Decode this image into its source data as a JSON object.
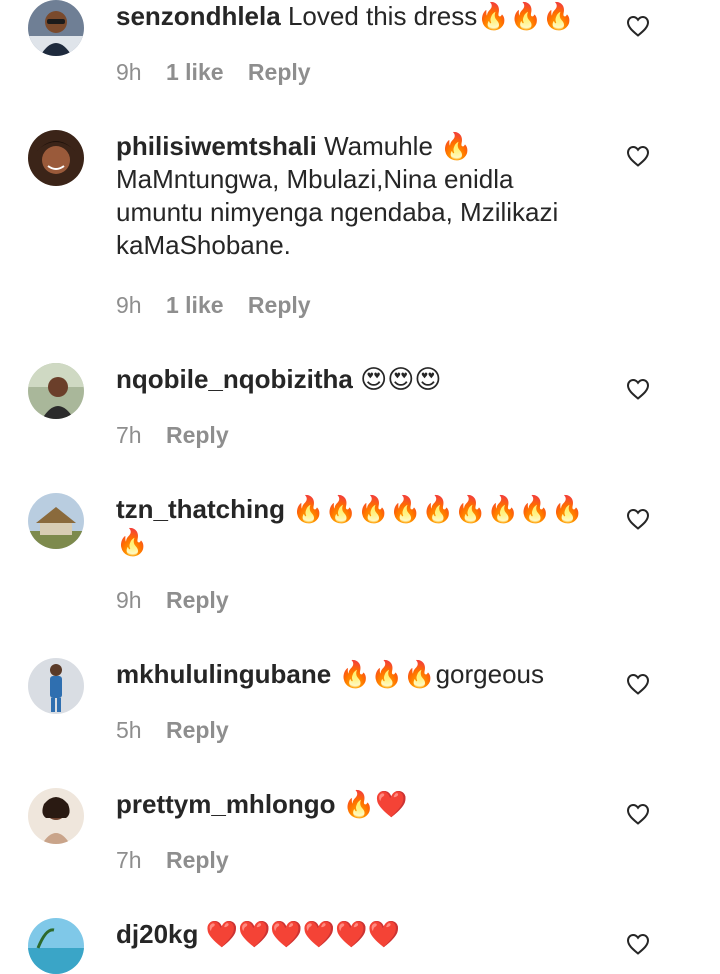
{
  "comments": [
    {
      "username": "senzondhlela",
      "text": "Loved this dress🔥🔥🔥",
      "time": "9h",
      "likes": "1 like",
      "reply": "Reply",
      "avatar_icon": "profile-photo-man-sunglasses"
    },
    {
      "username": "philisiwemtshali",
      "text": "Wamuhle 🔥 MaMntungwa, Mbulazi,Nina enidla umuntu nimyenga ngendaba, Mzilikazi kaMaShobane.",
      "time": "9h",
      "likes": "1 like",
      "reply": "Reply",
      "avatar_icon": "profile-photo-woman-smiling"
    },
    {
      "username": "nqobile_nqobizitha",
      "text": "😍😍😍",
      "time": "7h",
      "likes": "",
      "reply": "Reply",
      "avatar_icon": "profile-photo-woman-outdoors"
    },
    {
      "username": "tzn_thatching",
      "text": "🔥🔥🔥🔥🔥🔥🔥🔥🔥🔥",
      "time": "9h",
      "likes": "",
      "reply": "Reply",
      "avatar_icon": "profile-photo-thatched-house"
    },
    {
      "username": "mkhululingubane",
      "text": "🔥🔥🔥gorgeous",
      "time": "5h",
      "likes": "",
      "reply": "Reply",
      "avatar_icon": "profile-photo-man-standing"
    },
    {
      "username": "prettym_mhlongo",
      "text": "🔥❤️",
      "time": "7h",
      "likes": "",
      "reply": "Reply",
      "avatar_icon": "profile-photo-woman-portrait"
    },
    {
      "username": "dj20kg",
      "text": "❤️❤️❤️❤️❤️❤️",
      "time": "",
      "likes": "",
      "reply": "",
      "avatar_icon": "profile-photo-beach"
    }
  ],
  "colors": {
    "text": "#262626",
    "meta": "#8e8e8e",
    "background": "#ffffff"
  },
  "icons": {
    "like": "heart-outline-icon"
  }
}
